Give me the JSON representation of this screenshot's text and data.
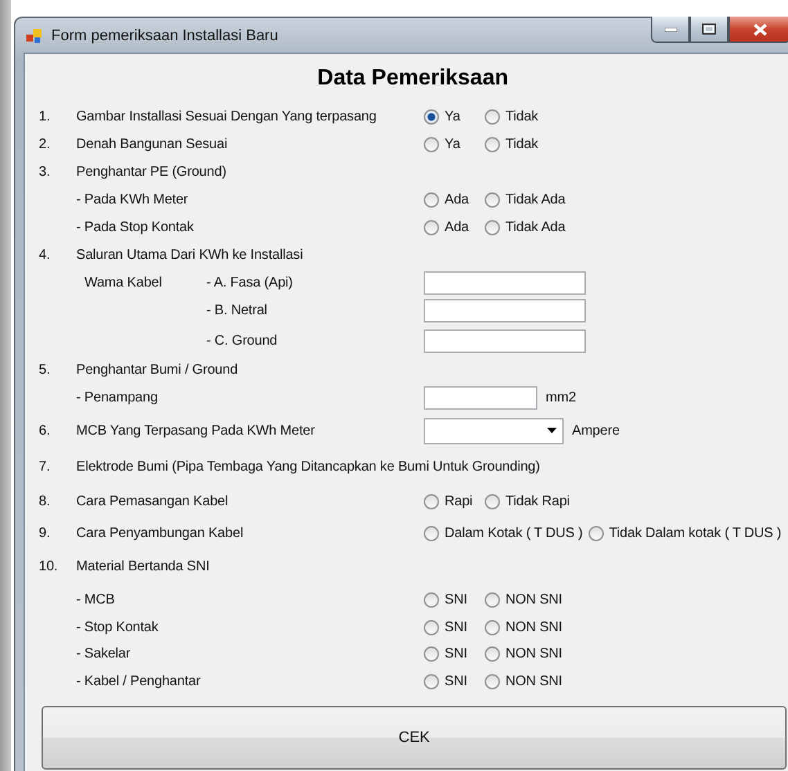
{
  "window": {
    "title": "Form pemeriksaan Installasi Baru"
  },
  "heading": "Data Pemeriksaan",
  "rows": [
    {
      "kind": "radio",
      "number": "1.",
      "label": "Gambar Installasi Sesuai Dengan Yang terpasang",
      "options": [
        {
          "label": "Ya",
          "selected": true
        },
        {
          "label": "Tidak",
          "selected": false
        }
      ]
    },
    {
      "kind": "radio",
      "number": "2.",
      "label": "Denah Bangunan Sesuai",
      "options": [
        {
          "label": "Ya",
          "selected": false
        },
        {
          "label": "Tidak",
          "selected": false
        }
      ]
    },
    {
      "kind": "label",
      "number": "3.",
      "label": "Penghantar PE (Ground)"
    },
    {
      "kind": "radio",
      "label": "- Pada KWh Meter",
      "options": [
        {
          "label": "Ada",
          "selected": false
        },
        {
          "label": "Tidak Ada",
          "selected": false
        }
      ]
    },
    {
      "kind": "radio",
      "label": "- Pada Stop Kontak",
      "options": [
        {
          "label": "Ada",
          "selected": false
        },
        {
          "label": "Tidak Ada",
          "selected": false
        }
      ]
    },
    {
      "kind": "label",
      "number": "4.",
      "label": "Saluran Utama Dari KWh ke Installasi"
    },
    {
      "kind": "text",
      "group": "Wama Kabel",
      "sublabel": "- A. Fasa (Api)"
    },
    {
      "kind": "text",
      "sublabel": "- B. Netral"
    },
    {
      "kind": "text",
      "sublabel": "- C. Ground"
    },
    {
      "kind": "label",
      "number": "5.",
      "label": "Penghantar Bumi / Ground"
    },
    {
      "kind": "short-text",
      "label": "- Penampang",
      "unit": "mm2"
    },
    {
      "kind": "combo",
      "number": "6.",
      "label": "MCB Yang Terpasang Pada KWh Meter",
      "unit": "Ampere"
    },
    {
      "kind": "label",
      "number": "7.",
      "label": "Elektrode Bumi (Pipa Tembaga Yang Ditancapkan ke Bumi Untuk Grounding)"
    },
    {
      "kind": "radio",
      "number": "8.",
      "label": "Cara Pemasangan Kabel",
      "options": [
        {
          "label": "Rapi",
          "selected": false
        },
        {
          "label": "Tidak Rapi",
          "selected": false
        }
      ]
    },
    {
      "kind": "radio",
      "number": "9.",
      "label": "Cara Penyambungan Kabel",
      "options": [
        {
          "label": "Dalam Kotak ( T DUS )",
          "selected": false
        },
        {
          "label": "Tidak Dalam kotak ( T DUS )",
          "selected": false
        }
      ]
    },
    {
      "kind": "label",
      "number": "10.",
      "label": "Material Bertanda SNI"
    },
    {
      "kind": "radio",
      "label": "- MCB",
      "options": [
        {
          "label": "SNI",
          "selected": false
        },
        {
          "label": "NON SNI",
          "selected": false
        }
      ]
    },
    {
      "kind": "radio",
      "label": "- Stop Kontak",
      "options": [
        {
          "label": "SNI",
          "selected": false
        },
        {
          "label": "NON SNI",
          "selected": false
        }
      ]
    },
    {
      "kind": "radio",
      "label": "- Sakelar",
      "options": [
        {
          "label": "SNI",
          "selected": false
        },
        {
          "label": "NON SNI",
          "selected": false
        }
      ]
    },
    {
      "kind": "radio",
      "label": "- Kabel / Penghantar",
      "options": [
        {
          "label": "SNI",
          "selected": false
        },
        {
          "label": "NON SNI",
          "selected": false
        }
      ]
    }
  ],
  "button": "CEK"
}
